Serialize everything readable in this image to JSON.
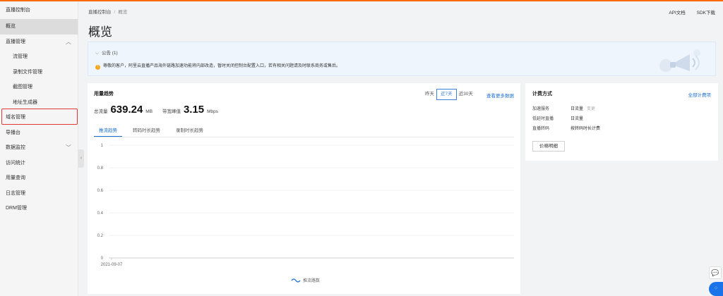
{
  "sidebar": {
    "title": "直播控制台",
    "items": [
      {
        "label": "概览",
        "active": true,
        "sub": false
      },
      {
        "label": "直播管理",
        "sub": false,
        "chevron": "chevron-up-icon"
      },
      {
        "label": "流管理",
        "sub": true
      },
      {
        "label": "录制文件管理",
        "sub": true
      },
      {
        "label": "截图管理",
        "sub": true
      },
      {
        "label": "地址生成器",
        "sub": true
      },
      {
        "label": "域名管理",
        "sub": false
      },
      {
        "label": "导播台",
        "sub": false
      },
      {
        "label": "数据监控",
        "sub": false,
        "chevron": "chevron-down-icon"
      },
      {
        "label": "访问统计",
        "sub": false
      },
      {
        "label": "用量查询",
        "sub": false
      },
      {
        "label": "日志管理",
        "sub": false
      },
      {
        "label": "DRM管理",
        "sub": false
      }
    ]
  },
  "header": {
    "breadcrumb_root": "直播控制台",
    "breadcrumb_sep": "/",
    "breadcrumb_current": "概览",
    "link_api": "API文档",
    "link_sdk": "SDK下载",
    "page_title": "概览"
  },
  "notice": {
    "title": "公告 (1)",
    "text": "尊敬的客户，阿里云直播产品海外链路加速功能将内部改造，暂时关闭控制台配置入口，若有相关问题请及时联系商务或售后。"
  },
  "usage": {
    "title": "用量趋势",
    "ranges": [
      "昨天",
      "近7天",
      "近30天"
    ],
    "selected_range": "近7天",
    "more_link": "查看更多数据",
    "total_label": "总流量",
    "total_value": "639.24",
    "total_unit": "MB",
    "peak_label": "带宽峰值",
    "peak_value": "3.15",
    "peak_unit": "Mbps",
    "tabs": [
      "推流趋势",
      "转码时长趋势",
      "录制时长趋势"
    ],
    "selected_tab": "推流趋势"
  },
  "chart_data": {
    "type": "line",
    "x": [
      "2021-09-07"
    ],
    "series": [
      {
        "name": "推流路数",
        "values": []
      }
    ],
    "yticks": [
      "1",
      "0.8",
      "0.6",
      "0.4",
      "0.2",
      "0"
    ],
    "ylim": [
      0,
      1
    ],
    "grid": true,
    "legend": "bottom-center"
  },
  "billing": {
    "title": "计费方式",
    "all_link": "全部计费项",
    "rows": [
      {
        "k": "加速服务",
        "v": "日流量",
        "tag": "变更"
      },
      {
        "k": "低延时直播",
        "v": "日流量",
        "tag": ""
      },
      {
        "k": "直播转码",
        "v": "按转码时长计费",
        "tag": ""
      }
    ],
    "price_btn": "价格明细"
  },
  "colors": {
    "accent": "#1a6fd1",
    "brand": "#ff6a00",
    "warn": "#f5a623",
    "highlight": "#e53935"
  }
}
